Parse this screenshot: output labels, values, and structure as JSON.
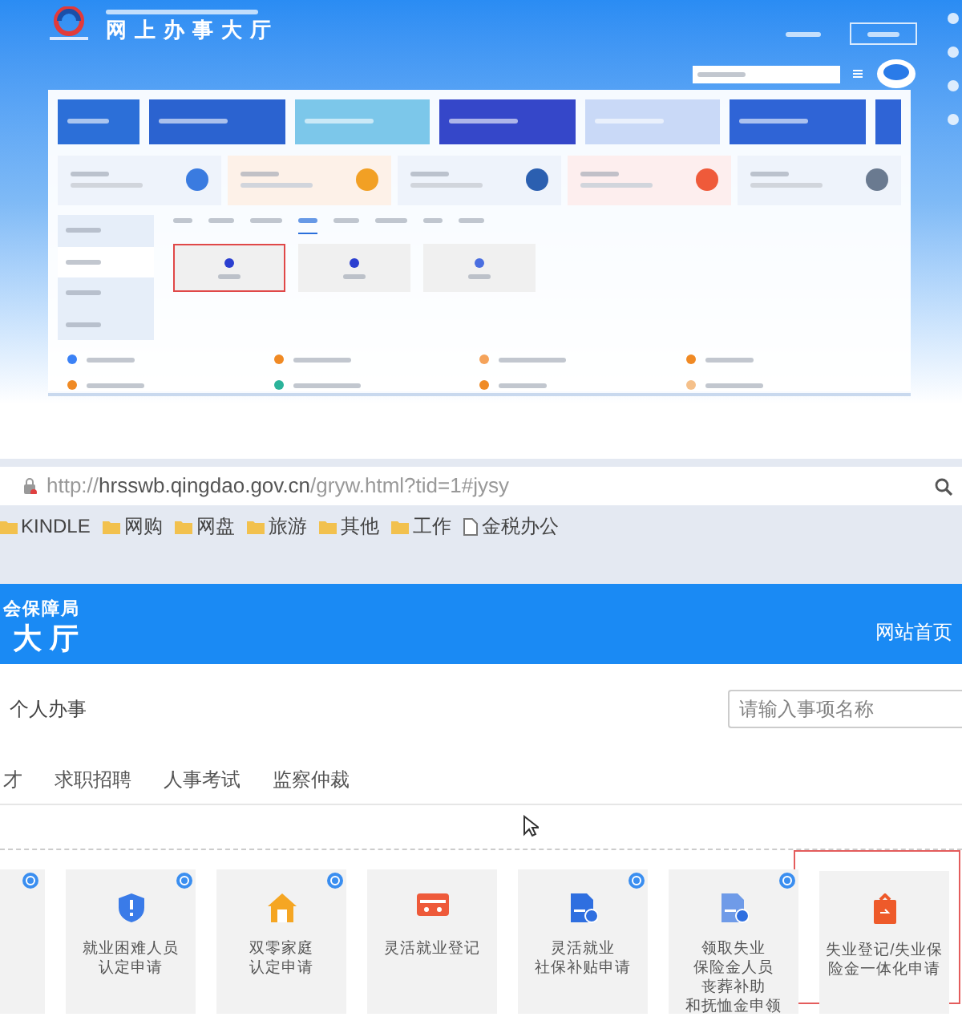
{
  "thumbnail": {
    "title": "网上办事大厅",
    "tabs": [
      {
        "selected": false
      },
      {
        "selected": false
      },
      {
        "selected": false
      },
      {
        "selected": true
      },
      {
        "selected": false
      },
      {
        "selected": false
      },
      {
        "selected": false
      },
      {
        "selected": false
      }
    ],
    "sidebar": [
      {
        "selected": false
      },
      {
        "selected": true
      },
      {
        "selected": false
      },
      {
        "selected": false
      }
    ],
    "tiles": [
      {
        "selected": true
      },
      {
        "selected": false
      },
      {
        "selected": false
      }
    ],
    "links": [
      {
        "color": "#3b82f6"
      },
      {
        "color": "#f08a24"
      },
      {
        "color": "#f5a35a"
      },
      {
        "color": "#f08a24"
      },
      {
        "color": "#f08a24"
      },
      {
        "color": "#2bb39a"
      },
      {
        "color": "#f08a24"
      },
      {
        "color": "#f5c08a"
      }
    ]
  },
  "browser": {
    "url_scheme": "http://",
    "url_host": "hrsswb.qingdao.gov.cn",
    "url_path": "/gryw.html?tid=1#jysy",
    "bookmarks": [
      {
        "kind": "folder",
        "label": "KINDLE"
      },
      {
        "kind": "folder",
        "label": "网购"
      },
      {
        "kind": "folder",
        "label": "网盘"
      },
      {
        "kind": "folder",
        "label": "旅游"
      },
      {
        "kind": "folder",
        "label": "其他"
      },
      {
        "kind": "folder",
        "label": "工作"
      },
      {
        "kind": "page",
        "label": "金税办公"
      }
    ]
  },
  "header": {
    "subtitle": "会保障局",
    "title": "大 厅",
    "home_link": "网站首页"
  },
  "section_title": "个人办事",
  "search": {
    "placeholder": "请输入事项名称"
  },
  "tabs": [
    {
      "label": "才"
    },
    {
      "label": "求职招聘"
    },
    {
      "label": "人事考试"
    },
    {
      "label": "监察仲裁"
    }
  ],
  "services": [
    {
      "info": true,
      "selected": false,
      "lines": [
        "就业困难人员",
        "认定申请"
      ]
    },
    {
      "info": true,
      "selected": false,
      "lines": [
        "双零家庭",
        "认定申请"
      ]
    },
    {
      "info": false,
      "selected": false,
      "lines": [
        "灵活就业登记"
      ]
    },
    {
      "info": true,
      "selected": false,
      "lines": [
        "灵活就业",
        "社保补贴申请"
      ]
    },
    {
      "info": true,
      "selected": false,
      "lines": [
        "领取失业",
        "保险金人员",
        "丧葬补助",
        "和抚恤金申领"
      ]
    },
    {
      "info": false,
      "selected": true,
      "lines": [
        "失业登记/失业保",
        "险金一体化申请"
      ]
    }
  ]
}
